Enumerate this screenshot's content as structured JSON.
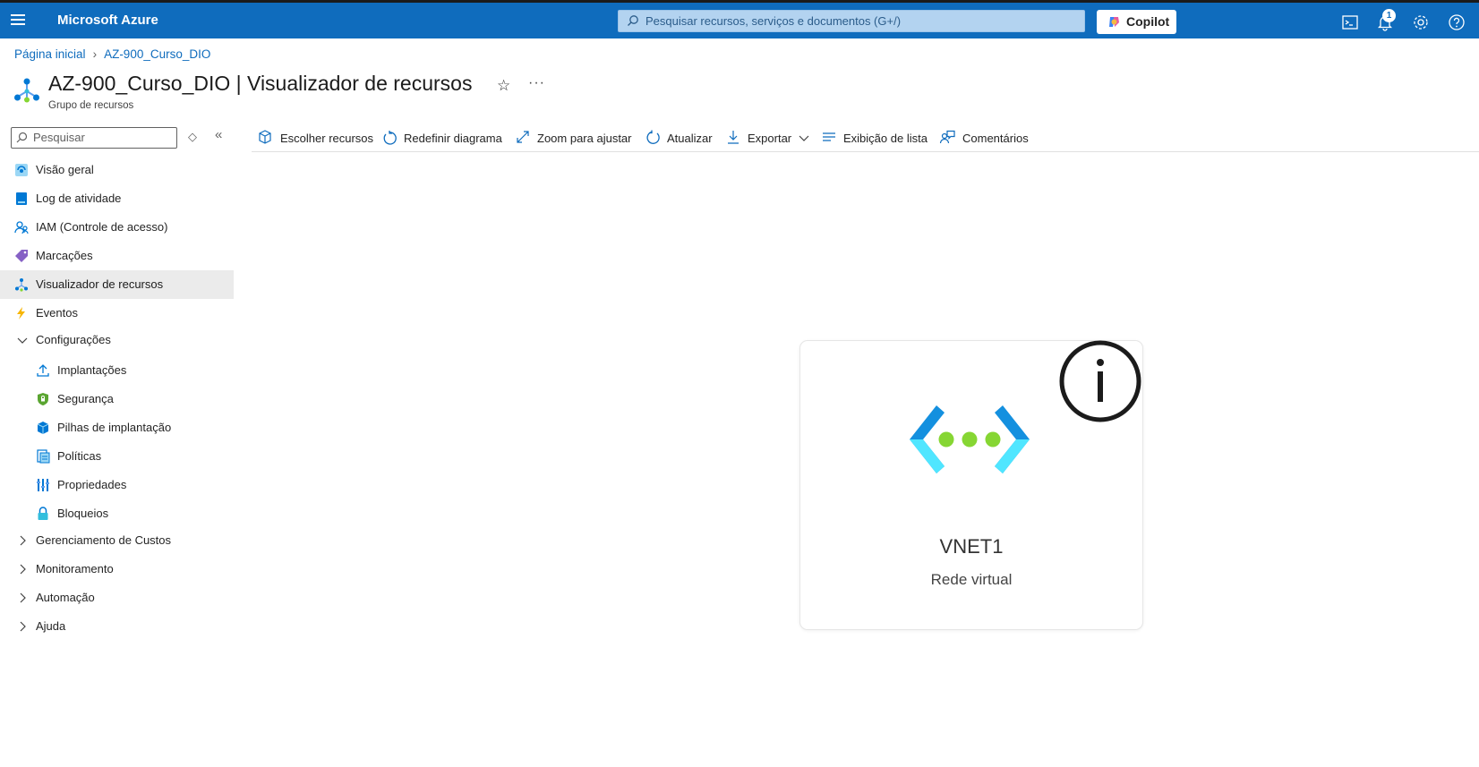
{
  "topbar": {
    "brand": "Microsoft Azure",
    "search_placeholder": "Pesquisar recursos, serviços e documentos (G+/)",
    "copilot_label": "Copilot",
    "notification_count": "1",
    "bg_color": "#0f6cbd"
  },
  "breadcrumb": {
    "items": [
      "Página inicial",
      "AZ-900_Curso_DIO"
    ]
  },
  "header": {
    "resource_name": "AZ-900_Curso_DIO",
    "separator": " | ",
    "page_name": "Visualizador de recursos",
    "subtitle": "Grupo de recursos"
  },
  "sidebar": {
    "search_placeholder": "Pesquisar",
    "items": [
      {
        "label": "Visão geral",
        "icon": "overview-icon"
      },
      {
        "label": "Log de atividade",
        "icon": "activity-log-icon"
      },
      {
        "label": "IAM (Controle de acesso)",
        "icon": "iam-icon"
      },
      {
        "label": "Marcações",
        "icon": "tag-icon"
      },
      {
        "label": "Visualizador de recursos",
        "icon": "resource-visualizer-icon",
        "active": true
      },
      {
        "label": "Eventos",
        "icon": "lightning-icon"
      },
      {
        "label": "Configurações",
        "icon": "chevron-down-icon",
        "expanded": true
      },
      {
        "label": "Implantações",
        "icon": "deployments-icon"
      },
      {
        "label": "Segurança",
        "icon": "shield-icon"
      },
      {
        "label": "Pilhas de implantação",
        "icon": "deployment-stacks-icon"
      },
      {
        "label": "Políticas",
        "icon": "policy-icon"
      },
      {
        "label": "Propriedades",
        "icon": "properties-icon"
      },
      {
        "label": "Bloqueios",
        "icon": "lock-icon"
      },
      {
        "label": "Gerenciamento de Custos",
        "icon": "chevron-right-icon"
      },
      {
        "label": "Monitoramento",
        "icon": "chevron-right-icon"
      },
      {
        "label": "Automação",
        "icon": "chevron-right-icon"
      },
      {
        "label": "Ajuda",
        "icon": "chevron-right-icon"
      }
    ]
  },
  "toolbar": {
    "choose_resources": "Escolher recursos",
    "reset_diagram": "Redefinir diagrama",
    "zoom_to_fit": "Zoom para ajustar",
    "refresh": "Atualizar",
    "export": "Exportar",
    "list_view": "Exibição de lista",
    "feedback": "Comentários"
  },
  "diagram": {
    "resource_name": "VNET1",
    "resource_type": "Rede virtual"
  }
}
